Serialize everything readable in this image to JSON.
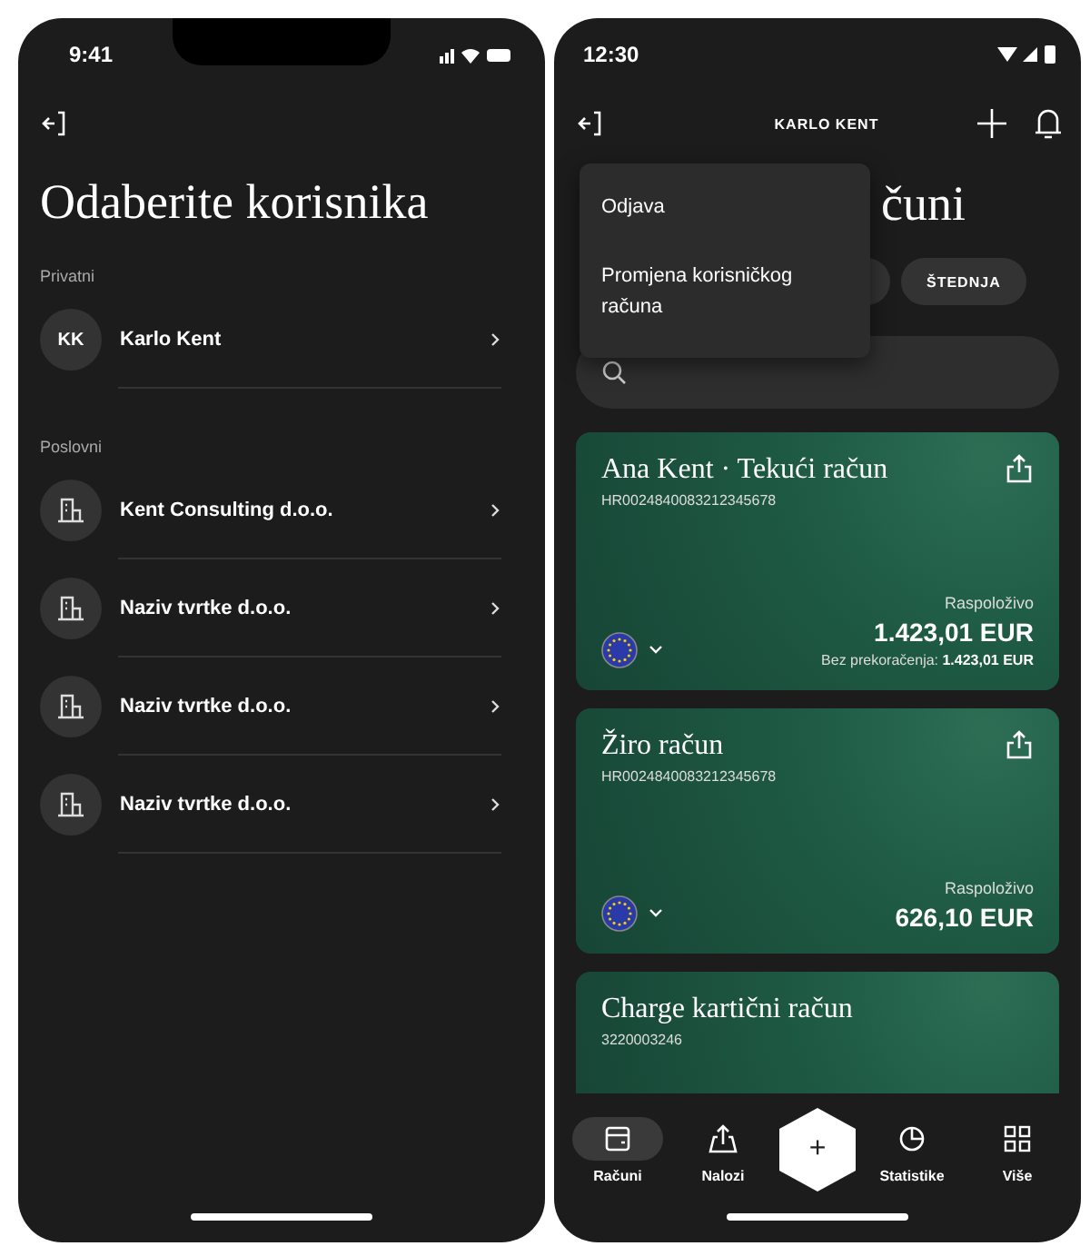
{
  "user_select": {
    "status_time": "9:41",
    "title": "Odaberite korisnika",
    "sections": [
      {
        "label": "Privatni",
        "items": [
          {
            "kind": "person",
            "initials": "KK",
            "name": "Karlo Kent"
          }
        ]
      },
      {
        "label": "Poslovni",
        "items": [
          {
            "kind": "company",
            "name": "Kent Consulting d.o.o."
          },
          {
            "kind": "company",
            "name": "Naziv tvrtke d.o.o."
          },
          {
            "kind": "company",
            "name": "Naziv tvrtke d.o.o."
          },
          {
            "kind": "company",
            "name": "Naziv tvrtke d.o.o."
          }
        ]
      }
    ]
  },
  "accounts": {
    "status_time": "12:30",
    "header_name": "KARLO KENT",
    "title": "čuni",
    "menu": [
      {
        "label": "Odjava"
      },
      {
        "label": "Promjena korisničkog računa"
      }
    ],
    "filter_chips": [
      {
        "label": "ŠTEDNJA"
      }
    ],
    "cards": [
      {
        "title": "Ana Kent · Tekući račun",
        "number": "HR0024840083212345678",
        "available_label": "Raspoloživo",
        "amount": "1.423,01 EUR",
        "note": "Bez prekoračenja: **1.423,01 EUR**"
      },
      {
        "title": "Žiro račun",
        "number": "HR0024840083212345678",
        "available_label": "Raspoloživo",
        "amount": "626,10 EUR"
      },
      {
        "title": "Charge kartični račun",
        "number": "3220003246"
      }
    ],
    "nav": [
      {
        "kind": "tab",
        "label": "Računi",
        "selected": true
      },
      {
        "kind": "tab",
        "label": "Nalozi",
        "selected": false
      },
      {
        "kind": "add",
        "label": "+"
      },
      {
        "kind": "tab",
        "label": "Statistike",
        "selected": false
      },
      {
        "kind": "tab",
        "label": "Više",
        "selected": false
      }
    ]
  }
}
